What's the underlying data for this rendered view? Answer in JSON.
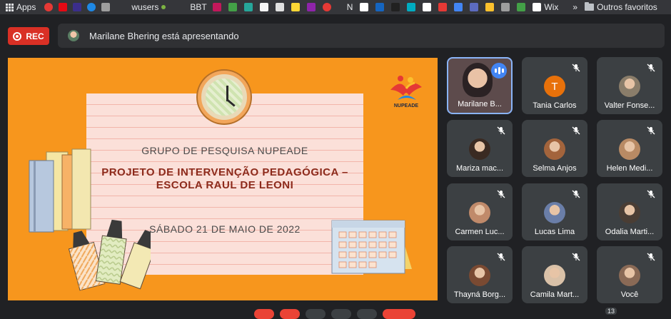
{
  "bookmarks": {
    "apps_label": "Apps",
    "items": [
      "wusers",
      "BBT",
      "N",
      "Wix"
    ],
    "more_label": "»",
    "folder_label": "Outros favoritos"
  },
  "header": {
    "rec_label": "REC",
    "presenting_text": "Marilane Bhering está apresentando"
  },
  "slide": {
    "title": "GRUPO DE PESQUISA NUPEADE",
    "subtitle_line1": "PROJETO DE INTERVENÇÃO PEDAGÓGICA –",
    "subtitle_line2": "ESCOLA RAUL DE LEONI",
    "date": "SÁBADO 21 DE MAIO DE 2022",
    "logo_text": "NUPEADE"
  },
  "participants": [
    {
      "name": "Marilane B...",
      "type": "video",
      "speaking": true
    },
    {
      "name": "Tania Carlos",
      "type": "letter",
      "letter": "T",
      "color": "#e8710a"
    },
    {
      "name": "Valter Fonse...",
      "type": "photo",
      "color": "#8a7d6a"
    },
    {
      "name": "Mariza mac...",
      "type": "photo",
      "color": "#3a2a22"
    },
    {
      "name": "Selma Anjos",
      "type": "photo",
      "color": "#a3643c"
    },
    {
      "name": "Helen Medi...",
      "type": "photo",
      "color": "#b88a64"
    },
    {
      "name": "Carmen Luc...",
      "type": "photo",
      "color": "#c08a6a"
    },
    {
      "name": "Lucas Lima",
      "type": "photo",
      "color": "#6a7ea8"
    },
    {
      "name": "Odalia Marti...",
      "type": "photo",
      "color": "#4a3d34"
    },
    {
      "name": "Thayná Borg...",
      "type": "photo",
      "color": "#7a4a32"
    },
    {
      "name": "Camila Mart...",
      "type": "photo",
      "color": "#d9c1a8"
    },
    {
      "name": "Você",
      "type": "photo",
      "color": "#8a6a56"
    }
  ],
  "overflow_count": "13",
  "colors": {
    "background": "#202124",
    "tile": "#3c4043",
    "rec": "#d93025",
    "stage": "#f7961d",
    "accent": "#8ab4f8"
  }
}
